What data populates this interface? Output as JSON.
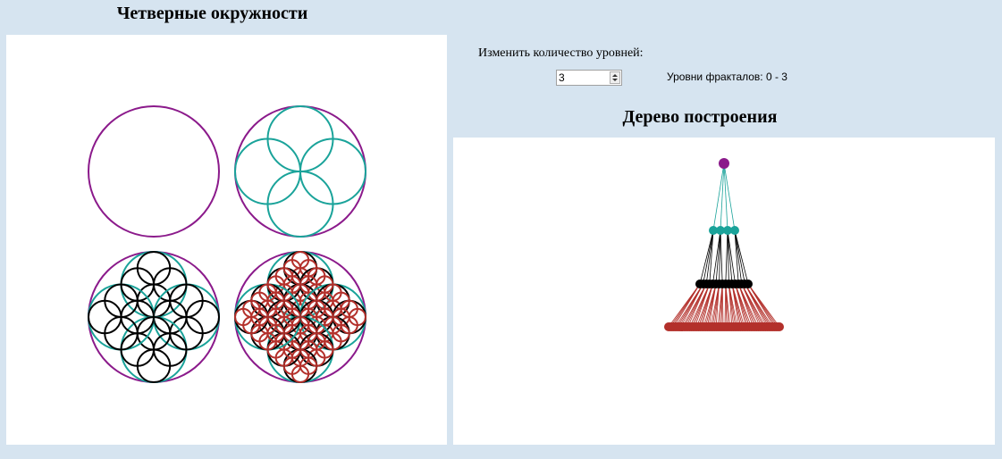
{
  "left": {
    "title": "Четверные окружности"
  },
  "controls": {
    "label": "Изменить количество уровней:",
    "levels_value": "3",
    "levels_range_text": "Уровни фракталов: 0 - 3"
  },
  "right": {
    "title": "Дерево построения"
  },
  "colors": {
    "level0": "#8b1a8b",
    "level1": "#1aa39a",
    "level2": "#000000",
    "level3": "#b3302b",
    "background": "#d6e4f0"
  }
}
